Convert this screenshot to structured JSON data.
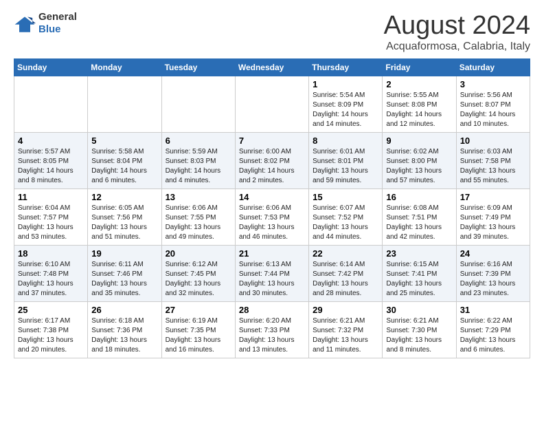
{
  "header": {
    "logo_general": "General",
    "logo_blue": "Blue",
    "title": "August 2024",
    "subtitle": "Acquaformosa, Calabria, Italy"
  },
  "weekdays": [
    "Sunday",
    "Monday",
    "Tuesday",
    "Wednesday",
    "Thursday",
    "Friday",
    "Saturday"
  ],
  "weeks": [
    [
      {
        "day": "",
        "info": ""
      },
      {
        "day": "",
        "info": ""
      },
      {
        "day": "",
        "info": ""
      },
      {
        "day": "",
        "info": ""
      },
      {
        "day": "1",
        "info": "Sunrise: 5:54 AM\nSunset: 8:09 PM\nDaylight: 14 hours\nand 14 minutes."
      },
      {
        "day": "2",
        "info": "Sunrise: 5:55 AM\nSunset: 8:08 PM\nDaylight: 14 hours\nand 12 minutes."
      },
      {
        "day": "3",
        "info": "Sunrise: 5:56 AM\nSunset: 8:07 PM\nDaylight: 14 hours\nand 10 minutes."
      }
    ],
    [
      {
        "day": "4",
        "info": "Sunrise: 5:57 AM\nSunset: 8:05 PM\nDaylight: 14 hours\nand 8 minutes."
      },
      {
        "day": "5",
        "info": "Sunrise: 5:58 AM\nSunset: 8:04 PM\nDaylight: 14 hours\nand 6 minutes."
      },
      {
        "day": "6",
        "info": "Sunrise: 5:59 AM\nSunset: 8:03 PM\nDaylight: 14 hours\nand 4 minutes."
      },
      {
        "day": "7",
        "info": "Sunrise: 6:00 AM\nSunset: 8:02 PM\nDaylight: 14 hours\nand 2 minutes."
      },
      {
        "day": "8",
        "info": "Sunrise: 6:01 AM\nSunset: 8:01 PM\nDaylight: 13 hours\nand 59 minutes."
      },
      {
        "day": "9",
        "info": "Sunrise: 6:02 AM\nSunset: 8:00 PM\nDaylight: 13 hours\nand 57 minutes."
      },
      {
        "day": "10",
        "info": "Sunrise: 6:03 AM\nSunset: 7:58 PM\nDaylight: 13 hours\nand 55 minutes."
      }
    ],
    [
      {
        "day": "11",
        "info": "Sunrise: 6:04 AM\nSunset: 7:57 PM\nDaylight: 13 hours\nand 53 minutes."
      },
      {
        "day": "12",
        "info": "Sunrise: 6:05 AM\nSunset: 7:56 PM\nDaylight: 13 hours\nand 51 minutes."
      },
      {
        "day": "13",
        "info": "Sunrise: 6:06 AM\nSunset: 7:55 PM\nDaylight: 13 hours\nand 49 minutes."
      },
      {
        "day": "14",
        "info": "Sunrise: 6:06 AM\nSunset: 7:53 PM\nDaylight: 13 hours\nand 46 minutes."
      },
      {
        "day": "15",
        "info": "Sunrise: 6:07 AM\nSunset: 7:52 PM\nDaylight: 13 hours\nand 44 minutes."
      },
      {
        "day": "16",
        "info": "Sunrise: 6:08 AM\nSunset: 7:51 PM\nDaylight: 13 hours\nand 42 minutes."
      },
      {
        "day": "17",
        "info": "Sunrise: 6:09 AM\nSunset: 7:49 PM\nDaylight: 13 hours\nand 39 minutes."
      }
    ],
    [
      {
        "day": "18",
        "info": "Sunrise: 6:10 AM\nSunset: 7:48 PM\nDaylight: 13 hours\nand 37 minutes."
      },
      {
        "day": "19",
        "info": "Sunrise: 6:11 AM\nSunset: 7:46 PM\nDaylight: 13 hours\nand 35 minutes."
      },
      {
        "day": "20",
        "info": "Sunrise: 6:12 AM\nSunset: 7:45 PM\nDaylight: 13 hours\nand 32 minutes."
      },
      {
        "day": "21",
        "info": "Sunrise: 6:13 AM\nSunset: 7:44 PM\nDaylight: 13 hours\nand 30 minutes."
      },
      {
        "day": "22",
        "info": "Sunrise: 6:14 AM\nSunset: 7:42 PM\nDaylight: 13 hours\nand 28 minutes."
      },
      {
        "day": "23",
        "info": "Sunrise: 6:15 AM\nSunset: 7:41 PM\nDaylight: 13 hours\nand 25 minutes."
      },
      {
        "day": "24",
        "info": "Sunrise: 6:16 AM\nSunset: 7:39 PM\nDaylight: 13 hours\nand 23 minutes."
      }
    ],
    [
      {
        "day": "25",
        "info": "Sunrise: 6:17 AM\nSunset: 7:38 PM\nDaylight: 13 hours\nand 20 minutes."
      },
      {
        "day": "26",
        "info": "Sunrise: 6:18 AM\nSunset: 7:36 PM\nDaylight: 13 hours\nand 18 minutes."
      },
      {
        "day": "27",
        "info": "Sunrise: 6:19 AM\nSunset: 7:35 PM\nDaylight: 13 hours\nand 16 minutes."
      },
      {
        "day": "28",
        "info": "Sunrise: 6:20 AM\nSunset: 7:33 PM\nDaylight: 13 hours\nand 13 minutes."
      },
      {
        "day": "29",
        "info": "Sunrise: 6:21 AM\nSunset: 7:32 PM\nDaylight: 13 hours\nand 11 minutes."
      },
      {
        "day": "30",
        "info": "Sunrise: 6:21 AM\nSunset: 7:30 PM\nDaylight: 13 hours\nand 8 minutes."
      },
      {
        "day": "31",
        "info": "Sunrise: 6:22 AM\nSunset: 7:29 PM\nDaylight: 13 hours\nand 6 minutes."
      }
    ]
  ]
}
